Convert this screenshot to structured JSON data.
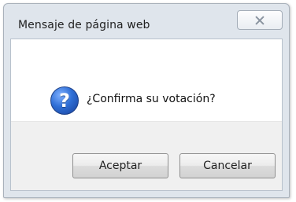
{
  "window": {
    "title": "Mensaje de página web",
    "close_icon": "close-icon"
  },
  "message": {
    "icon": "question-icon",
    "icon_glyph": "?",
    "text": "¿Confirma su votación?"
  },
  "buttons": {
    "accept_label": "Aceptar",
    "cancel_label": "Cancelar"
  },
  "colors": {
    "dialog_frame": "#dfe5ec",
    "button_area": "#f0f0f0",
    "icon_blue": "#2f6fd6"
  }
}
